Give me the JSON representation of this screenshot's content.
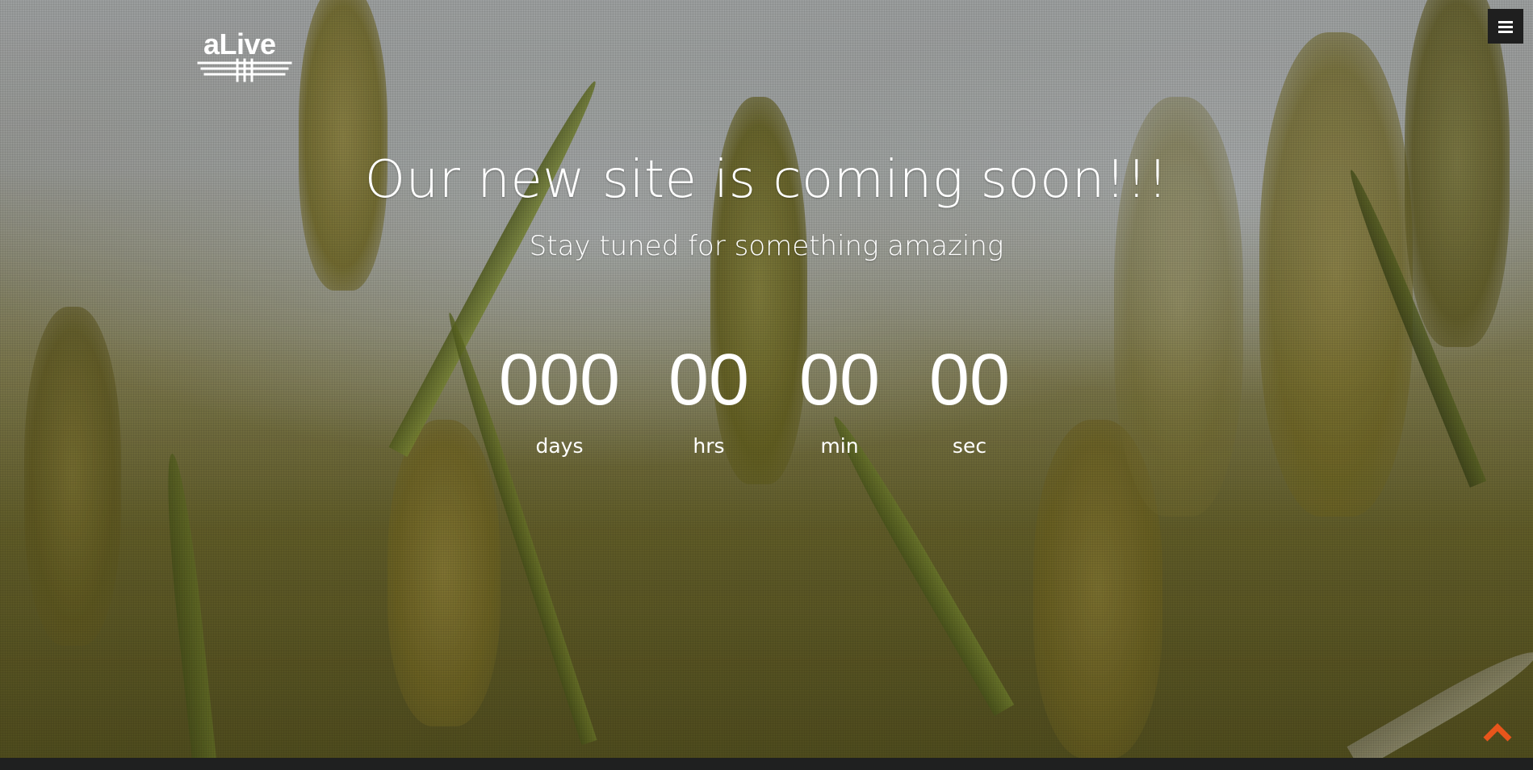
{
  "brand": {
    "logo_text": "aLive"
  },
  "nav": {
    "menu_icon": "hamburger-menu-icon"
  },
  "hero": {
    "headline": "Our new site is coming soon!!!",
    "subheadline": "Stay tuned for something amazing"
  },
  "countdown": {
    "units": [
      {
        "value": "000",
        "label": "days"
      },
      {
        "value": "00",
        "label": "hrs"
      },
      {
        "value": "00",
        "label": "min"
      },
      {
        "value": "00",
        "label": "sec"
      }
    ]
  },
  "scroll_top": {
    "icon": "chevron-up-icon",
    "color": "#e8551b"
  }
}
